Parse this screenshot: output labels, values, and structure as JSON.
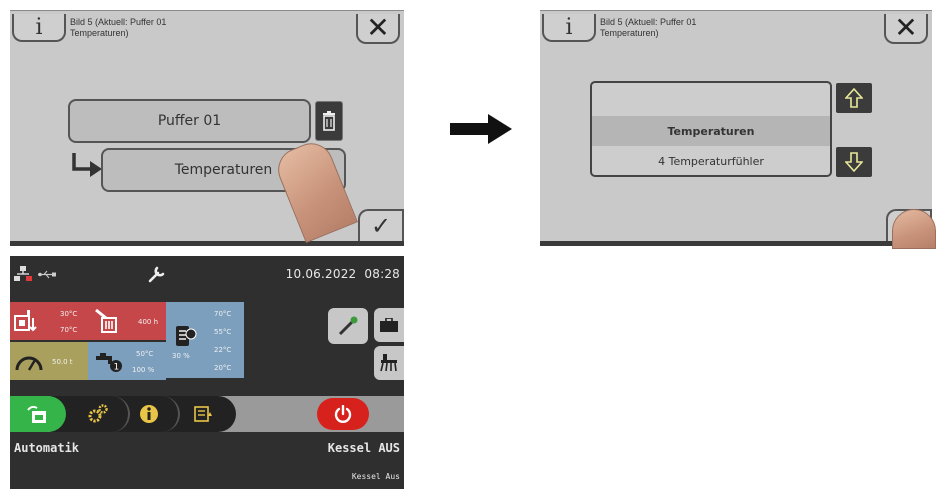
{
  "panel1": {
    "title": "Bild 5 (Aktuell: Puffer 01\nTemperaturen)",
    "close_glyph": "✕",
    "info_glyph": "i",
    "buffer_button": "Puffer 01",
    "temp_button": "Temperaturen",
    "check_glyph": "✓"
  },
  "panel2": {
    "title": "Bild 5 (Aktuell: Puffer 01\nTemperaturen)",
    "close_glyph": "✕",
    "info_glyph": "i",
    "picker": {
      "items": [
        "",
        "Temperaturen",
        "4 Temperaturfühler"
      ],
      "selected": "Temperaturen"
    },
    "check_glyph": "✓"
  },
  "controller": {
    "date": "10.06.2022",
    "time": "08:28",
    "tiles": {
      "boiler": {
        "t1": "30°C",
        "t2": "70°C",
        "color": "#c6474a"
      },
      "ash": {
        "value": "400 h",
        "color": "#c6474a"
      },
      "buffer": {
        "t1": "70°C",
        "t2": "55°C",
        "t3": "22°C",
        "t4": "20°C",
        "level": "30 %",
        "color": "#7c9fbd"
      },
      "pellets": {
        "value": "50.0 t",
        "color": "#a8a05c"
      },
      "hot_water": {
        "t1": "50°C",
        "t2": "100 %",
        "color": "#7c9fbd"
      }
    },
    "mode_label": "Automatik",
    "state_label": "Kessel AUS",
    "status_label": "Kessel Aus",
    "accent_green": "#35b44a",
    "power_red": "#d6211c"
  }
}
